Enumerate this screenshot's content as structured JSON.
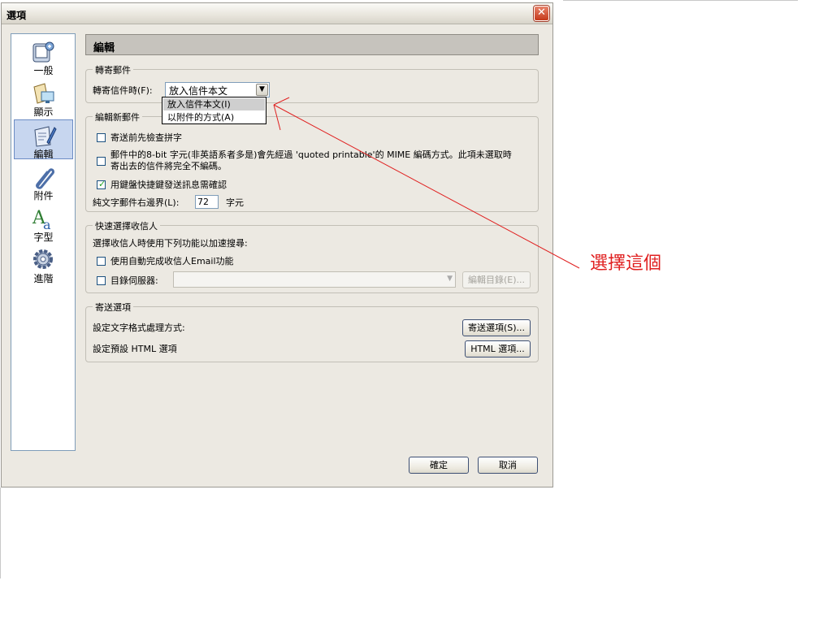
{
  "window": {
    "title": "選項",
    "close_symbol": "✕"
  },
  "sidebar": {
    "items": [
      {
        "label": "一般",
        "icon": "general-icon"
      },
      {
        "label": "顯示",
        "icon": "display-icon"
      },
      {
        "label": "編輯",
        "icon": "edit-icon",
        "selected": true
      },
      {
        "label": "附件",
        "icon": "paperclip-icon"
      },
      {
        "label": "字型",
        "icon": "font-icon"
      },
      {
        "label": "進階",
        "icon": "gear-icon"
      }
    ]
  },
  "header": {
    "title": "編輯"
  },
  "forward_group": {
    "title": "轉寄郵件",
    "label": "轉寄信件時(F):",
    "selected": "放入信件本文",
    "options": [
      "放入信件本文(I)",
      "以附件的方式(A)"
    ]
  },
  "compose_group": {
    "title": "編輯新郵件",
    "spellcheck": {
      "label": "寄送前先檢查拼字",
      "checked": false
    },
    "mime": {
      "line1": "郵件中的8-bit 字元(非英語系者多是)會先經過 'quoted printable'的 MIME 編碼方式。此項未選取時",
      "line2": "寄出去的信件將完全不編碼。",
      "checked": false
    },
    "confirm": {
      "label": "用鍵盤快捷鍵發送訊息需確認",
      "checked": true
    },
    "wrap": {
      "label": "純文字郵件右邊界(L):",
      "value": "72",
      "unit": "字元"
    }
  },
  "recipient_group": {
    "title": "快速選擇收信人",
    "desc": "選擇收信人時使用下列功能以加速搜尋:",
    "autocomplete": {
      "label": "使用自動完成收信人Email功能",
      "checked": false
    },
    "directory": {
      "label": "目錄伺服器:",
      "checked": false,
      "button": "編輯目錄(E)..."
    }
  },
  "send_group": {
    "title": "寄送選項",
    "text_format": {
      "label": "設定文字格式處理方式:",
      "button": "寄送選項(S)..."
    },
    "html": {
      "label": "設定預設 HTML 選項",
      "button": "HTML 選項..."
    }
  },
  "footer": {
    "ok": "確定",
    "cancel": "取消"
  },
  "annotation": {
    "text": "選擇這個",
    "color": "#e02020"
  }
}
